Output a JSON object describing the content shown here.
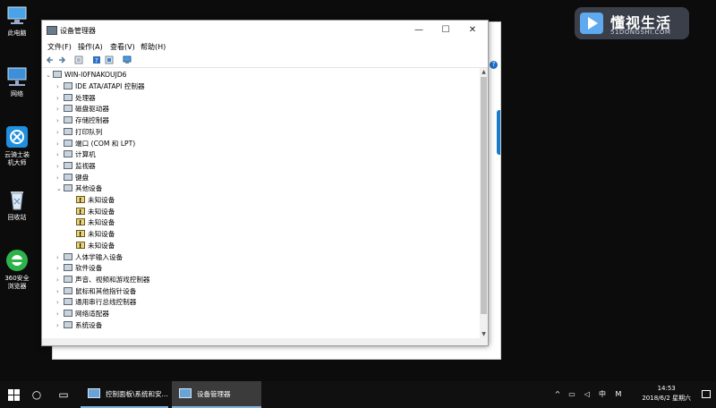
{
  "desktop": {
    "icons": [
      {
        "label": "此电脑"
      },
      {
        "label": "网络"
      },
      {
        "label": "云骑士装机大师"
      },
      {
        "label": "回收站"
      },
      {
        "label": "360安全浏览器"
      }
    ],
    "watermark": {
      "title": "懂视生活",
      "subtitle": "51DONGSHI.COM"
    }
  },
  "device_manager": {
    "title": "设备管理器",
    "window_buttons": {
      "minimize": "—",
      "maximize": "☐",
      "close": "✕"
    },
    "menu": [
      "文件(F)",
      "操作(A)",
      "查看(V)",
      "帮助(H)"
    ],
    "computer_name": "WIN-I0FNAKOUJD6",
    "tree": [
      {
        "label": "IDE ATA/ATAPI 控制器",
        "expander": "›"
      },
      {
        "label": "处理器",
        "expander": "›"
      },
      {
        "label": "磁盘驱动器",
        "expander": "›"
      },
      {
        "label": "存储控制器",
        "expander": "›"
      },
      {
        "label": "打印队列",
        "expander": "›"
      },
      {
        "label": "端口 (COM 和 LPT)",
        "expander": "›"
      },
      {
        "label": "计算机",
        "expander": "›"
      },
      {
        "label": "监视器",
        "expander": "›"
      },
      {
        "label": "键盘",
        "expander": "›"
      },
      {
        "label": "其他设备",
        "expander": "⌄"
      },
      {
        "label": "未知设备",
        "child": true
      },
      {
        "label": "未知设备",
        "child": true
      },
      {
        "label": "未知设备",
        "child": true
      },
      {
        "label": "未知设备",
        "child": true
      },
      {
        "label": "未知设备",
        "child": true
      },
      {
        "label": "人体学输入设备",
        "expander": "›"
      },
      {
        "label": "软件设备",
        "expander": "›"
      },
      {
        "label": "声音、视频和游戏控制器",
        "expander": "›"
      },
      {
        "label": "鼠标和其他指针设备",
        "expander": "›"
      },
      {
        "label": "通用串行总线控制器",
        "expander": "›"
      },
      {
        "label": "网络适配器",
        "expander": "›"
      },
      {
        "label": "系统设备",
        "expander": "›"
      }
    ]
  },
  "taskbar": {
    "tasks": [
      {
        "label": "控制面板\\系统和安..."
      },
      {
        "label": "设备管理器"
      }
    ],
    "tray": {
      "ime": "中",
      "m": "M"
    },
    "clock": {
      "time": "14:53",
      "date": "2018/6/2 星期六"
    }
  }
}
